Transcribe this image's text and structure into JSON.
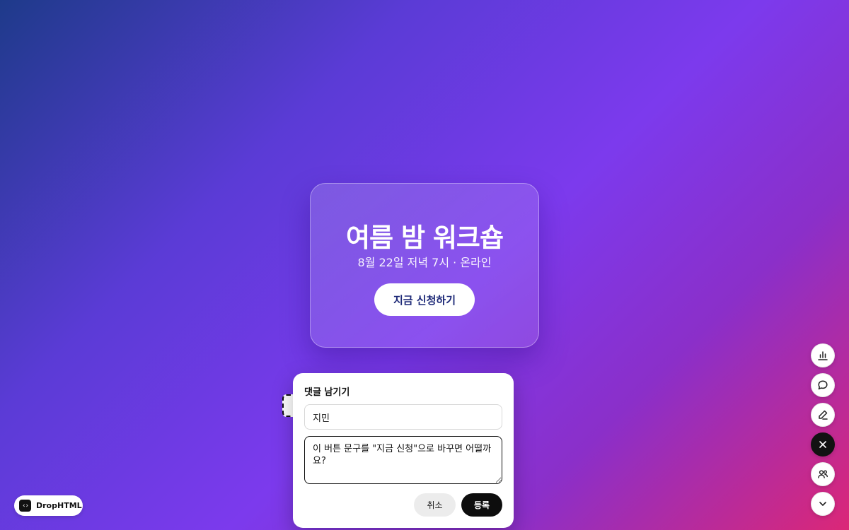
{
  "hero": {
    "title": "여름 밤 워크숍",
    "subtitle": "8월 22일 저녁 7시 · 온라인",
    "cta_label": "지금 신청하기"
  },
  "comment_panel": {
    "title": "댓글 남기기",
    "name_value": "지민",
    "comment_value": "이 버튼 문구를 \"지금 신청\"으로 바꾸면 어떨까요?",
    "cancel_label": "취소",
    "submit_label": "등록"
  },
  "brand": {
    "logo_glyph": "‹›",
    "name": "DropHTML"
  },
  "toolbar": {
    "items": [
      {
        "icon": "bar-chart-icon",
        "active": false
      },
      {
        "icon": "comment-icon",
        "active": false
      },
      {
        "icon": "pencil-icon",
        "active": false
      },
      {
        "icon": "close-icon",
        "active": true
      },
      {
        "icon": "users-icon",
        "active": false
      },
      {
        "icon": "chevron-down-icon",
        "active": false
      }
    ]
  },
  "colors": {
    "cta_text": "#1e2a78",
    "submit_bg": "#0d0d0d",
    "active_tool_bg": "#121212"
  }
}
